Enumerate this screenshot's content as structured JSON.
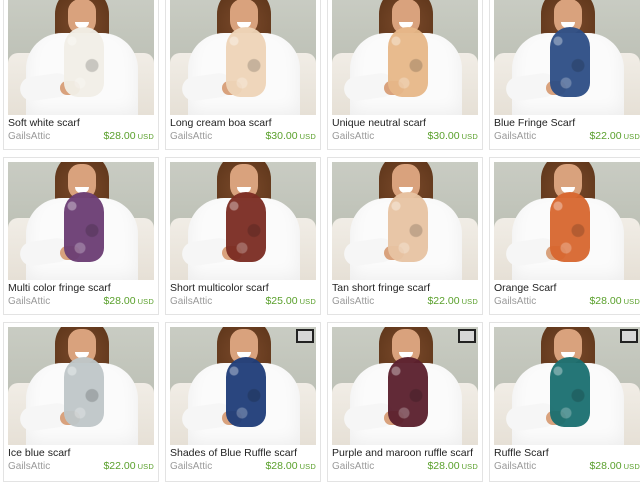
{
  "listings": [
    {
      "title": "Soft white scarf",
      "shop": "GailsAttic",
      "price": "$28.00",
      "currency": "USD",
      "scarf_color": "#f2efe7",
      "scarf_name": "white-scarf"
    },
    {
      "title": "Long cream boa scarf",
      "shop": "GailsAttic",
      "price": "$30.00",
      "currency": "USD",
      "scarf_color": "#efd5b8",
      "scarf_name": "cream-boa-scarf"
    },
    {
      "title": "Unique neutral scarf",
      "shop": "GailsAttic",
      "price": "$30.00",
      "currency": "USD",
      "scarf_color": "#e7b889",
      "scarf_name": "neutral-scarf"
    },
    {
      "title": "Blue Fringe Scarf",
      "shop": "GailsAttic",
      "price": "$22.00",
      "currency": "USD",
      "scarf_color": "#2d4e86",
      "scarf_name": "blue-fringe-scarf"
    },
    {
      "title": "Multi color fringe scarf",
      "shop": "GailsAttic",
      "price": "$28.00",
      "currency": "USD",
      "scarf_color": "#6b3d74",
      "scarf_name": "multicolor-fringe-scarf"
    },
    {
      "title": "Short multicolor scarf",
      "shop": "GailsAttic",
      "price": "$25.00",
      "currency": "USD",
      "scarf_color": "#7b2c22",
      "scarf_name": "short-multicolor-scarf"
    },
    {
      "title": "Tan short fringe scarf",
      "shop": "GailsAttic",
      "price": "$22.00",
      "currency": "USD",
      "scarf_color": "#e8c4a3",
      "scarf_name": "tan-fringe-scarf"
    },
    {
      "title": "Orange Scarf",
      "shop": "GailsAttic",
      "price": "$28.00",
      "currency": "USD",
      "scarf_color": "#d8672f",
      "scarf_name": "orange-scarf"
    },
    {
      "title": "Ice blue scarf",
      "shop": "GailsAttic",
      "price": "$22.00",
      "currency": "USD",
      "scarf_color": "#bfc7c9",
      "scarf_name": "ice-blue-scarf"
    },
    {
      "title": "Shades of Blue Ruffle scarf",
      "shop": "GailsAttic",
      "price": "$28.00",
      "currency": "USD",
      "scarf_color": "#1f3d79",
      "scarf_name": "blue-ruffle-scarf"
    },
    {
      "title": "Purple and maroon ruffle scarf",
      "shop": "GailsAttic",
      "price": "$28.00",
      "currency": "USD",
      "scarf_color": "#5a1f2d",
      "scarf_name": "purple-maroon-ruffle-scarf"
    },
    {
      "title": "Ruffle Scarf",
      "shop": "GailsAttic",
      "price": "$28.00",
      "currency": "USD",
      "scarf_color": "#1a6f70",
      "scarf_name": "teal-ruffle-scarf"
    }
  ]
}
